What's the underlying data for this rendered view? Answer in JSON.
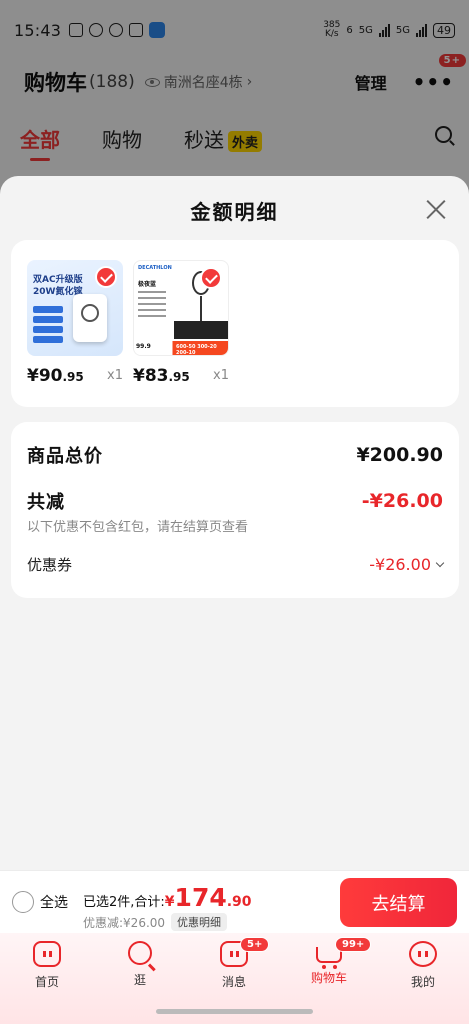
{
  "status_bar": {
    "time": "15:43",
    "net_speed_value": "385",
    "net_speed_unit": "K/s",
    "net1": "6",
    "net2": "5G",
    "net3": "5G",
    "battery": "49"
  },
  "header": {
    "title": "购物车",
    "count": "(188)",
    "location": "南洲名座4栋",
    "manage": "管理",
    "more_badge": "5+"
  },
  "tabs": [
    {
      "label": "全部",
      "active": true
    },
    {
      "label": "购物",
      "active": false
    },
    {
      "label": "秒送",
      "badge": "外卖",
      "active": false
    }
  ],
  "sheet": {
    "title": "金额明细",
    "products": [
      {
        "price_int": "¥90",
        "price_dec": ".95",
        "qty": "x1",
        "image_text_1": "双AC升级版",
        "image_text_2": "20W氮化镓"
      },
      {
        "price_int": "¥83",
        "price_dec": ".95",
        "qty": "x1",
        "image_brand": "DECATHLON",
        "image_name": "极夜蓝",
        "image_price": "99.9",
        "image_promo": "600-50 300-20 200-10"
      }
    ],
    "summary": {
      "total_label": "商品总价",
      "total_value": "¥200.90",
      "discount_label": "共减",
      "discount_value": "-¥26.00",
      "note": "以下优惠不包含红包，请在结算页查看",
      "coupon_label": "优惠券",
      "coupon_value": "-¥26.00"
    }
  },
  "checkout": {
    "select_all": "全选",
    "selected_text": "已选2件,合计:",
    "currency": "¥",
    "amount_int": "174",
    "amount_dec": ".90",
    "discount_text": "优惠减:¥26.00",
    "detail_button": "优惠明细",
    "pay_button": "去结算"
  },
  "tabbar": [
    {
      "label": "首页",
      "icon": "home-icon"
    },
    {
      "label": "逛",
      "icon": "browse-icon"
    },
    {
      "label": "消息",
      "icon": "message-icon",
      "badge": "5+"
    },
    {
      "label": "购物车",
      "icon": "cart-icon",
      "badge": "99+",
      "active": true
    },
    {
      "label": "我的",
      "icon": "profile-icon"
    }
  ],
  "colors": {
    "accent": "#f23a3a",
    "price_red": "#e8262a"
  }
}
